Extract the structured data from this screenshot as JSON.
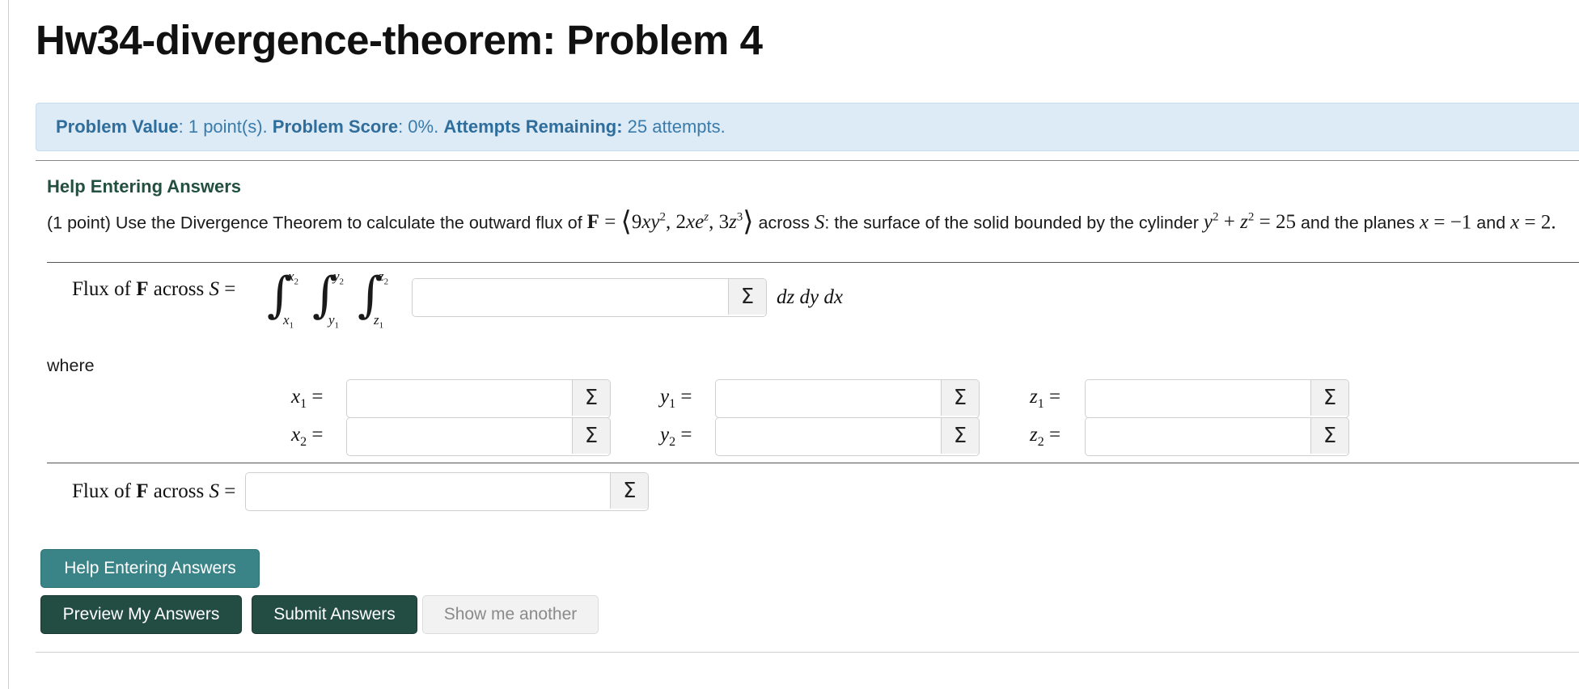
{
  "page_title": "Hw34-divergence-theorem: Problem 4",
  "info": {
    "value_label": "Problem Value",
    "value_text": ": 1 point(s). ",
    "score_label": "Problem Score",
    "score_text": ": 0%. ",
    "attempts_label": "Attempts Remaining:",
    "attempts_text": " 25 attempts."
  },
  "problem": {
    "help_heading": "Help Entering Answers",
    "intro": "(1 point) Use the Divergence Theorem to calculate the outward flux of",
    "across": "across",
    "surface_desc": ": the surface of the solid bounded by the cylinder",
    "and_planes": "and the planes",
    "and": "and",
    "where": "where"
  },
  "answers": {
    "flux_label": "Flux of F across S =",
    "integrand_value": "",
    "differentials": "dz dy dx",
    "x1_value": "",
    "x2_value": "",
    "y1_value": "",
    "y2_value": "",
    "z1_value": "",
    "z2_value": "",
    "flux_value": "",
    "sigma_symbol": "Σ"
  },
  "buttons": {
    "help": "Help Entering Answers",
    "preview": "Preview My Answers",
    "submit": "Submit Answers",
    "another": "Show me another"
  },
  "colors": {
    "info_bg": "#dcebf6",
    "info_text": "#3a7bab",
    "help_btn": "#3a8487",
    "primary_btn": "#234c43",
    "heading_green": "#234f3f"
  }
}
